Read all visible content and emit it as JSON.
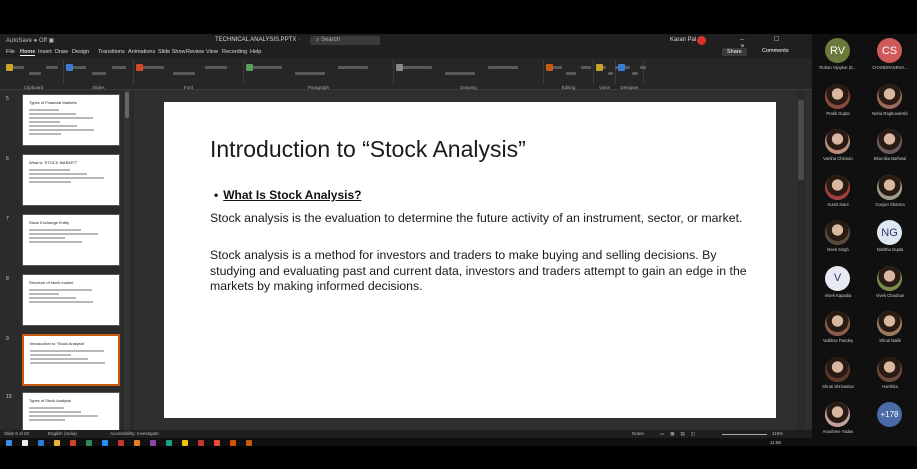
{
  "window": {
    "quick_access": "AutoSave ● Off ▣",
    "title": "TECHNICAL ANALYSIS.PPTX ·",
    "search_placeholder": "Search",
    "user": "Karan Pal",
    "controls": "─ ☐ ✕"
  },
  "ribbon_tabs": [
    "File",
    "Home",
    "Insert",
    "Draw",
    "Design",
    "Transitions",
    "Animations",
    "Slide Show",
    "Review",
    "View",
    "Recording",
    "Help"
  ],
  "active_tab": "Home",
  "share_label": "Share",
  "comments_label": "Comments",
  "ribbon_groups": [
    "Clipboard",
    "Slides",
    "Font",
    "Paragraph",
    "Drawing",
    "Editing",
    "Voice",
    "Designer"
  ],
  "thumbnails": [
    {
      "num": "5",
      "title": "Types of Financial Markets"
    },
    {
      "num": "6",
      "title": "What is “STOCK MARKET”"
    },
    {
      "num": "7",
      "title": "Stock Exchange Entity"
    },
    {
      "num": "8",
      "title": "Structure of stock market"
    },
    {
      "num": "9",
      "title": "Introduction to “Stock Analysis”"
    },
    {
      "num": "10",
      "title": "Types of Stock Analysis"
    }
  ],
  "slide": {
    "title": "Introduction to “Stock Analysis”",
    "bullet": "What Is Stock Analysis?",
    "para1": "Stock analysis is the evaluation to determine the future activity of an instrument, sector, or market.",
    "para2": "Stock analysis is a method for investors and traders to make buying and selling decisions. By studying and evaluating past and current data, investors and traders attempt to gain an edge in the markets by making informed decisions."
  },
  "status": {
    "slide_count": "Slide 9 of 20",
    "language": "English (India)",
    "accessibility": "Accessibility: Investigate",
    "notes": "Notes",
    "zoom": "115%"
  },
  "taskbar_time": "11:58",
  "participants": [
    {
      "initials": "RV",
      "name": "Rohan Vijaykar (E...",
      "color": "#6a7a3a"
    },
    {
      "initials": "CS",
      "name": "CHANDRASENA...",
      "color": "#d05a5a"
    },
    {
      "initials": "",
      "name": "Pratik Gupta",
      "color": "#8a4a3a"
    },
    {
      "initials": "",
      "name": "Neha Raghuvanshi",
      "color": "#9a6a5a"
    },
    {
      "initials": "",
      "name": "Varsha Chinnan",
      "color": "#b88a7a"
    },
    {
      "initials": "",
      "name": "Bhumika Bathwal",
      "color": "#6a5a5a"
    },
    {
      "initials": "",
      "name": "Sumit Saini",
      "color": "#a04040"
    },
    {
      "initials": "",
      "name": "Gunjan Sharma",
      "color": "#a09a8a"
    },
    {
      "initials": "",
      "name": "Neeti Singh",
      "color": "#5a4a3a"
    },
    {
      "initials": "NG",
      "name": "Nishtha Gupta",
      "color": "#e0e6f0"
    },
    {
      "initials": "V",
      "name": "Vivek Kapadia",
      "color": "#e8eaf2"
    },
    {
      "initials": "",
      "name": "Vivek Chauhan",
      "color": "#7a8a4a"
    },
    {
      "initials": "",
      "name": "Vaibhav Pandey",
      "color": "#8a5a4a"
    },
    {
      "initials": "",
      "name": "Shruti Malik",
      "color": "#9a7a5a"
    },
    {
      "initials": "",
      "name": "Shruti Shrivastav",
      "color": "#5a3a2a"
    },
    {
      "initials": "",
      "name": "Harshita",
      "color": "#6a4a3a"
    },
    {
      "initials": "",
      "name": "Anushree Yadav",
      "color": "#c0a0a0"
    },
    {
      "initials": "+178",
      "name": "",
      "color": "#4a6aa8"
    }
  ]
}
